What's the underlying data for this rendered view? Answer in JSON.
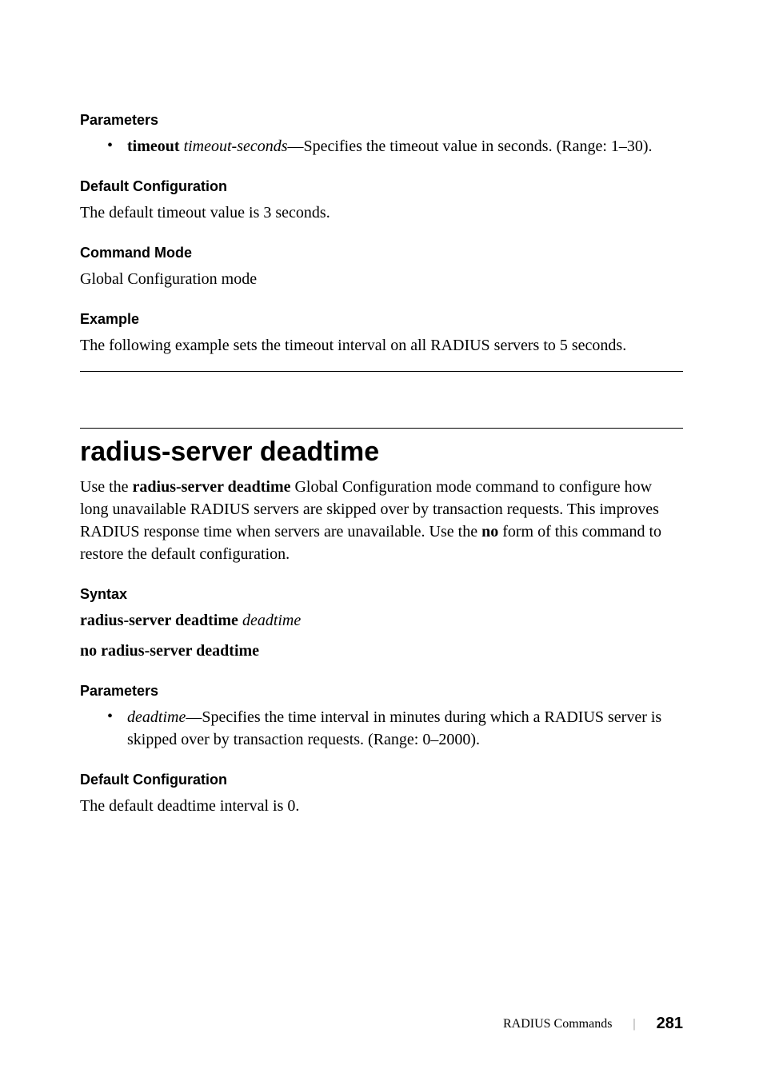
{
  "section1": {
    "parameters_heading": "Parameters",
    "bullet_bold": "timeout",
    "bullet_italic": "timeout-seconds",
    "bullet_rest": "—Specifies the timeout value in seconds. (Range: 1–30).",
    "default_heading": "Default Configuration",
    "default_text": "The default timeout value is 3 seconds.",
    "mode_heading": "Command Mode",
    "mode_text": "Global Configuration mode",
    "example_heading": "Example",
    "example_text": "The following example sets the timeout interval on all RADIUS servers to 5 seconds."
  },
  "section2": {
    "title": "radius-server deadtime",
    "desc_part1": "Use the ",
    "desc_bold1": "radius-server deadtime",
    "desc_part2": " Global Configuration mode command to configure how long unavailable RADIUS servers are skipped over by transaction requests. This improves RADIUS response time when servers are unavailable. Use the ",
    "desc_bold2": "no",
    "desc_part3": " form of this command to restore the default configuration.",
    "syntax_heading": "Syntax",
    "syntax_line1_bold": "radius-server deadtime",
    "syntax_line1_italic": "deadtime",
    "syntax_line2": "no radius-server deadtime",
    "parameters_heading": "Parameters",
    "bullet_italic": "deadtime",
    "bullet_rest": "—Specifies the time interval in minutes during which a RADIUS server is skipped over by transaction requests. (Range: 0–2000).",
    "default_heading": "Default Configuration",
    "default_text": "The default deadtime interval is 0."
  },
  "footer": {
    "chapter": "RADIUS Commands",
    "page": "281"
  }
}
